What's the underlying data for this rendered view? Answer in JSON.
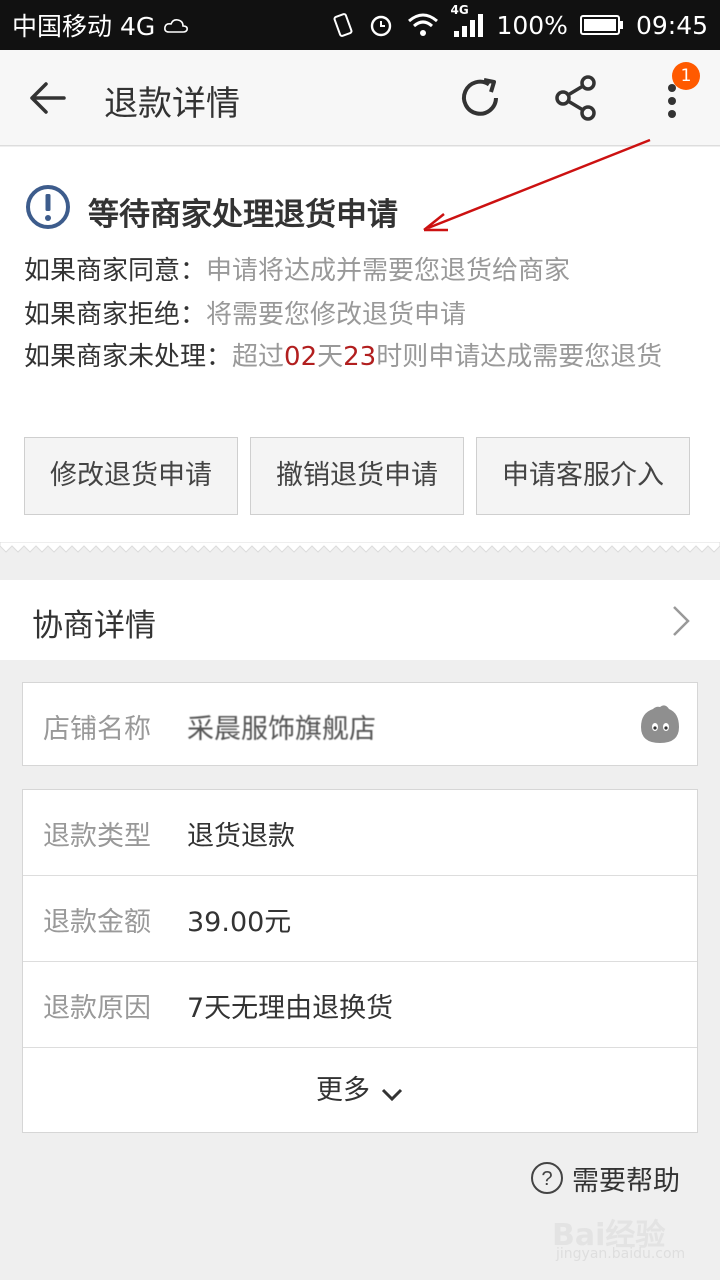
{
  "status_bar": {
    "carrier": "中国移动 4G",
    "network_small": "4G",
    "battery": "100%",
    "time": "09:45"
  },
  "app_bar": {
    "title": "退款详情",
    "badge_count": "1",
    "icons": [
      "back-arrow-icon",
      "refresh-icon",
      "share-icon",
      "more-vertical-icon"
    ]
  },
  "status_card": {
    "title": "等待商家处理退货申请",
    "lines": [
      {
        "label": "如果商家同意：",
        "value": "申请将达成并需要您退货给商家"
      },
      {
        "label": "如果商家拒绝：",
        "value": "将需要您修改退货申请"
      },
      {
        "label": "如果商家未处理：",
        "pre": "超过",
        "days": "02",
        "days_unit": "天",
        "hours": "23",
        "post": "时则申请达成需要您退货"
      }
    ],
    "buttons": [
      "修改退货申请",
      "撤销退货申请",
      "申请客服介入"
    ]
  },
  "negotiation": {
    "title": "协商详情"
  },
  "shop": {
    "label": "店铺名称",
    "value": "采晨服饰旗舰店"
  },
  "details": [
    {
      "label": "退款类型",
      "value": "退货退款"
    },
    {
      "label": "退款金额",
      "value": "39.00元"
    },
    {
      "label": "退款原因",
      "value": "7天无理由退换货"
    }
  ],
  "more_label": "更多",
  "help_label": "需要帮助",
  "watermark": {
    "main": "Bai经验",
    "sub": "jingyan.baidu.com"
  },
  "colors": {
    "accent_badge": "#ff5a00",
    "highlight_red": "#b21f1f",
    "icon_blue": "#3d5c8c",
    "annotation_red": "#cc1111"
  }
}
